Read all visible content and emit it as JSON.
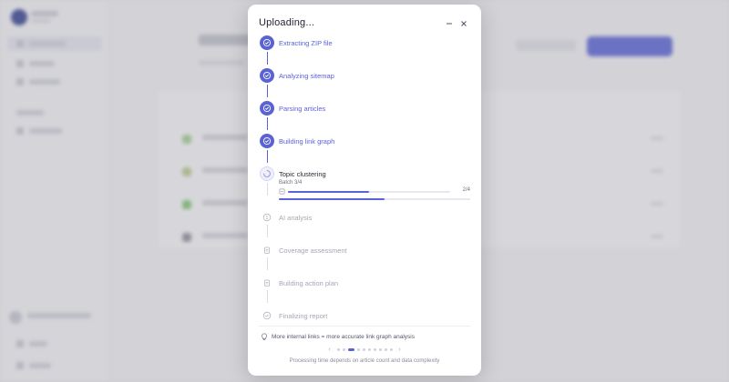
{
  "modal": {
    "title": "Uploading...",
    "minimize_icon": "minus-icon",
    "close_icon": "close-icon"
  },
  "steps": [
    {
      "label": "Extracting ZIP file",
      "status": "done",
      "icon": "check-icon"
    },
    {
      "label": "Analyzing sitemap",
      "status": "done",
      "icon": "check-icon"
    },
    {
      "label": "Parsing articles",
      "status": "done",
      "icon": "check-icon"
    },
    {
      "label": "Building link graph",
      "status": "done",
      "icon": "check-icon"
    },
    {
      "label": "Topic clustering",
      "status": "active",
      "icon": "spinner-icon"
    },
    {
      "label": "AI analysis",
      "status": "pending",
      "icon": "bulb-icon"
    },
    {
      "label": "Coverage assessment",
      "status": "pending",
      "icon": "clipboard-icon"
    },
    {
      "label": "Building action plan",
      "status": "pending",
      "icon": "clipboard-icon"
    },
    {
      "label": "Finalizing report",
      "status": "pending",
      "icon": "check-circle-icon"
    }
  ],
  "active_step": {
    "batch_text": "Batch 3/4",
    "sub_count": "2/4",
    "sub_progress": 0.5,
    "overall_progress": 0.55
  },
  "tip": {
    "icon": "lightbulb-icon",
    "text": "More internal links = more accurate link graph analysis"
  },
  "pager": {
    "prev_icon": "chevron-left-icon",
    "next_icon": "chevron-right-icon",
    "dot_count": 10,
    "active_dot": 2
  },
  "footer_note": "Processing time depends on article count and data complexity",
  "colors": {
    "accent": "#5a63d6",
    "pending": "#a6a7b3"
  }
}
